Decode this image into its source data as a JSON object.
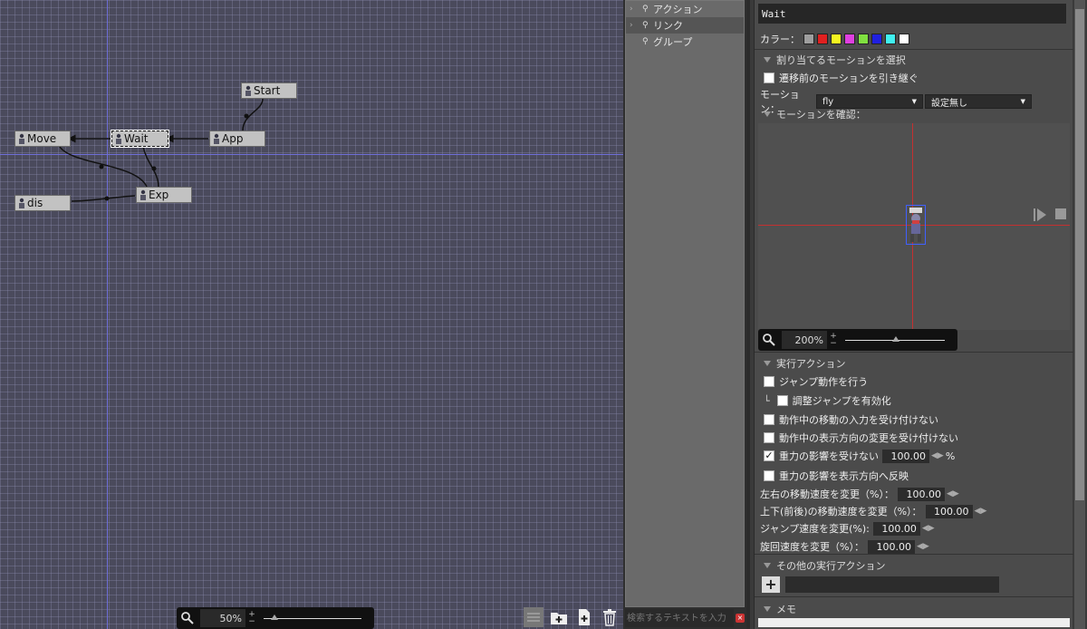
{
  "canvas": {
    "nodes": [
      {
        "id": "start",
        "label": "Start"
      },
      {
        "id": "move",
        "label": "Move"
      },
      {
        "id": "wait",
        "label": "Wait"
      },
      {
        "id": "app",
        "label": "App"
      },
      {
        "id": "exp",
        "label": "Exp"
      },
      {
        "id": "dis",
        "label": "dis"
      }
    ],
    "zoom_value": "50%"
  },
  "tree": {
    "items": [
      {
        "label": "アクション"
      },
      {
        "label": "リンク"
      },
      {
        "label": "グループ"
      }
    ],
    "search_placeholder": "検索するテキストを入力"
  },
  "props": {
    "name_value": "Wait",
    "color_label": "カラー：",
    "colors": [
      "#9e9e9e",
      "#e02020",
      "#f5f520",
      "#e040e0",
      "#80e040",
      "#2020e0",
      "#40f0f0",
      "#ffffff"
    ],
    "motion_section": "割り当てるモーションを選択",
    "inherit_motion": "遷移前のモーションを引き継ぐ",
    "motion_label": "モーション：",
    "motion_value": "fly",
    "motion_setting_value": "設定無し",
    "confirm_section": "モーションを確認：",
    "preview_zoom": "200%",
    "exec_section": "実行アクション",
    "jump": "ジャンプ動作を行う",
    "adjust_jump": "調整ジャンプを有効化",
    "no_move_input": "動作中の移動の入力を受け付けない",
    "no_dir_change": "動作中の表示方向の変更を受け付けない",
    "no_gravity": "重力の影響を受けない",
    "gravity_value": "100.00",
    "gravity_unit": "%",
    "gravity_reflect": "重力の影響を表示方向へ反映",
    "lr_speed_label": "左右の移動速度を変更（%）：",
    "lr_speed_value": "100.00",
    "ud_speed_label": "上下(前後)の移動速度を変更（%）：",
    "ud_speed_value": "100.00",
    "jump_speed_label": "ジャンプ速度を変更(%):",
    "jump_speed_value": "100.00",
    "rot_speed_label": "旋回速度を変更（%）：",
    "rot_speed_value": "100.00",
    "other_section": "その他の実行アクション",
    "memo_section": "メモ"
  }
}
